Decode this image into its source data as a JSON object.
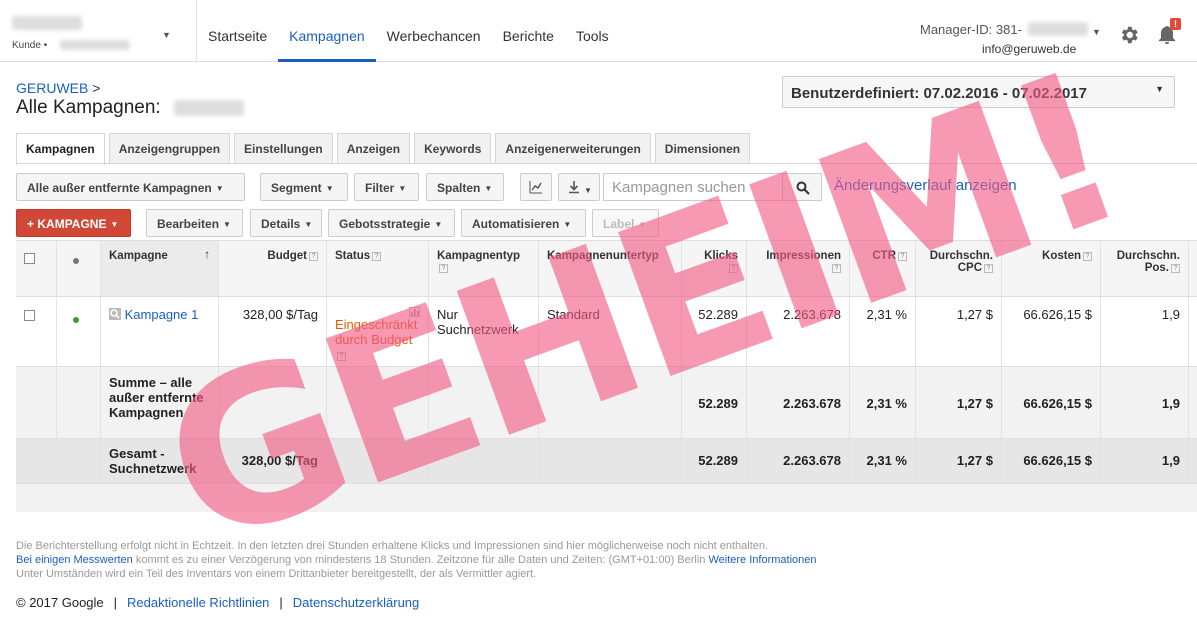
{
  "account": {
    "kunde_label": "Kunde •"
  },
  "nav": {
    "items": [
      {
        "label": "Startseite",
        "active": false
      },
      {
        "label": "Kampagnen",
        "active": true
      },
      {
        "label": "Werbechancen",
        "active": false
      },
      {
        "label": "Berichte",
        "active": false
      },
      {
        "label": "Tools",
        "active": false
      }
    ]
  },
  "header": {
    "manager_label": "Manager-ID: 381-",
    "email": "info@geruweb.de",
    "notification_badge": "!",
    "breadcrumb": "GERUWEB",
    "breadcrumb_sep": ">",
    "title": "Alle Kampagnen:",
    "date_range": "Benutzerdefiniert: 07.02.2016 - 07.02.2017"
  },
  "tabs": [
    {
      "label": "Kampagnen",
      "active": true
    },
    {
      "label": "Anzeigengruppen",
      "active": false
    },
    {
      "label": "Einstellungen",
      "active": false
    },
    {
      "label": "Anzeigen",
      "active": false
    },
    {
      "label": "Keywords",
      "active": false
    },
    {
      "label": "Anzeigenerweiterungen",
      "active": false
    },
    {
      "label": "Dimensionen",
      "active": false
    }
  ],
  "toolbar": {
    "filter_campaigns": "Alle außer entfernte Kampagnen",
    "segment": "Segment",
    "filter": "Filter",
    "columns": "Spalten",
    "search_placeholder": "Kampagnen suchen",
    "change_history": "Änderungsverlauf anzeigen",
    "add_campaign": "KAMPAGNE",
    "add_plus": "+",
    "edit": "Bearbeiten",
    "details": "Details",
    "bid_strategy": "Gebotsstrategie",
    "automate": "Automatisieren",
    "label": "Label"
  },
  "table": {
    "headers": {
      "campaign": "Kampagne",
      "budget": "Budget",
      "status": "Status",
      "type": "Kampagnentyp",
      "subtype": "Kampagnenuntertyp",
      "clicks": "Klicks",
      "impressions": "Impressionen",
      "ctr": "CTR",
      "cpc": "Durchschn. CPC",
      "cost": "Kosten",
      "pos": "Durchschn. Pos."
    },
    "rows": [
      {
        "campaign": "Kampagne 1",
        "budget": "328,00 $/Tag",
        "status": "Eingeschränkt durch Budget",
        "type": "Nur Suchnetzwerk",
        "subtype": "Standard",
        "clicks": "52.289",
        "impressions": "2.263.678",
        "ctr": "2,31 %",
        "cpc": "1,27 $",
        "cost": "66.626,15 $",
        "pos": "1,9"
      }
    ],
    "summary": {
      "label": "Summe – alle außer entfernte Kampagnen",
      "clicks": "52.289",
      "impressions": "2.263.678",
      "ctr": "2,31 %",
      "cpc": "1,27 $",
      "cost": "66.626,15 $",
      "pos": "1,9"
    },
    "total": {
      "label": "Gesamt - Suchnetzwerk",
      "budget": "328,00 $/Tag",
      "clicks": "52.289",
      "impressions": "2.263.678",
      "ctr": "2,31 %",
      "cpc": "1,27 $",
      "cost": "66.626,15 $",
      "pos": "1,9"
    }
  },
  "footer": {
    "line1": "Die Berichterstellung erfolgt nicht in Echtzeit. In den letzten drei Stunden erhaltene Klicks und Impressionen sind hier möglicherweise noch nicht enthalten.",
    "line2_link": "Bei einigen Messwerten",
    "line2_text": " kommt es zu einer Verzögerung von mindestens 18 Stunden. Zeitzone für alle Daten und Zeiten: (GMT+01:00) Berlin ",
    "line2_more": "Weitere Informationen",
    "line3": "Unter Umständen wird ein Teil des Inventars von einem Drittanbieter bereitgestellt, der als Vermittler agiert.",
    "copyright": "© 2017 Google",
    "link_editorial": "Redaktionelle Richtlinien",
    "link_privacy": "Datenschutzerklärung",
    "sep": "|"
  },
  "watermark": "GEHEIM!",
  "colors": {
    "accent": "#1a5fc1",
    "primary_button": "#d14836",
    "status_warning": "#e65c00",
    "watermark": "#f25a82"
  }
}
